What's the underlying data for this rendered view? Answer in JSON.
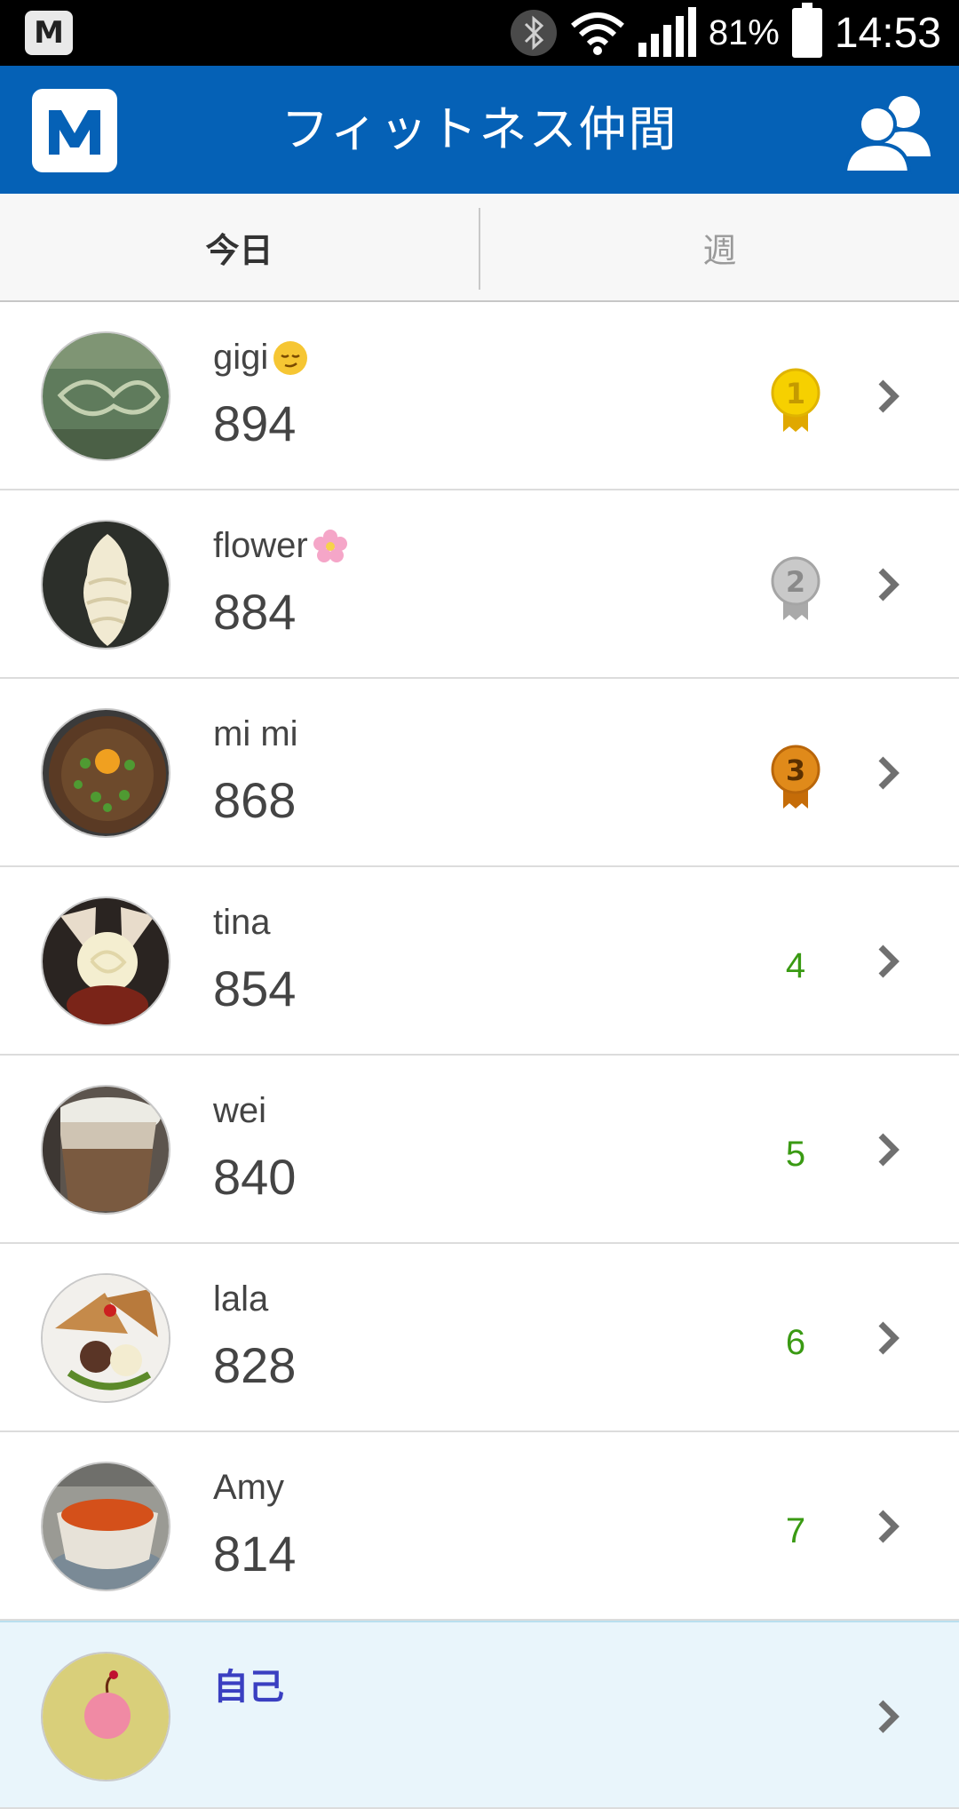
{
  "status_bar": {
    "app_icon_letter": "M",
    "battery_percent": "81%",
    "time": "14:53",
    "icons": [
      "app-m-icon",
      "bluetooth-icon",
      "wifi-icon",
      "signal-icon",
      "battery-icon"
    ]
  },
  "header": {
    "title": "フィットネス仲間",
    "logo_icon": "app-logo-icon",
    "friends_icon": "friends-icon",
    "color": "#0561b6"
  },
  "tabs": [
    {
      "label": "今日",
      "active": true
    },
    {
      "label": "週",
      "active": false
    }
  ],
  "leaderboard": [
    {
      "name": "gigi",
      "name_emoji": "relieved-face-emoji",
      "score": "894",
      "rank": "1",
      "medal": "gold-medal-icon"
    },
    {
      "name": "flower",
      "name_emoji": "cherry-blossom-emoji",
      "score": "884",
      "rank": "2",
      "medal": "silver-medal-icon"
    },
    {
      "name": "mi mi",
      "score": "868",
      "rank": "3",
      "medal": "bronze-medal-icon"
    },
    {
      "name": "tina",
      "score": "854",
      "rank": "4"
    },
    {
      "name": "wei",
      "score": "840",
      "rank": "5"
    },
    {
      "name": "lala",
      "score": "828",
      "rank": "6"
    },
    {
      "name": "Amy",
      "score": "814",
      "rank": "7"
    },
    {
      "name": "自己",
      "score": "",
      "rank": "",
      "is_self": true
    }
  ],
  "colors": {
    "rank_text": "#3a9a13",
    "self_name": "#3a3fc1",
    "gold": "#f2c600",
    "silver": "#b8b8b8",
    "bronze": "#d87b10"
  }
}
